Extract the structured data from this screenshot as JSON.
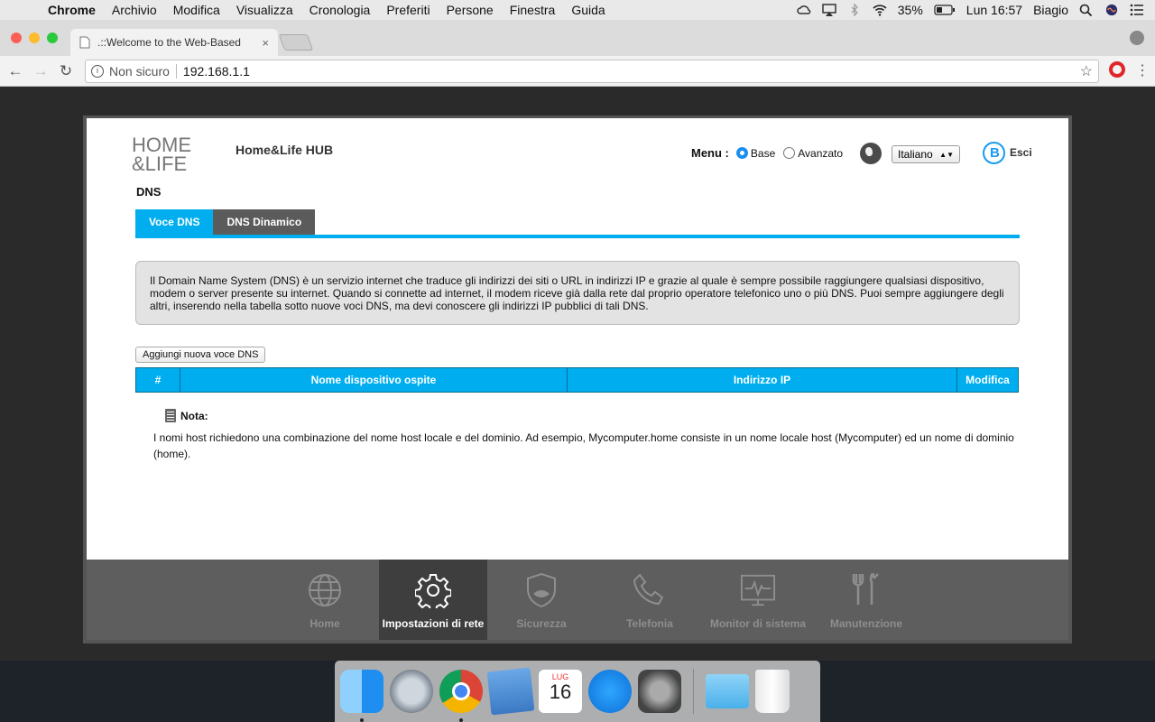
{
  "menubar": {
    "app": "Chrome",
    "items": [
      "Archivio",
      "Modifica",
      "Visualizza",
      "Cronologia",
      "Preferiti",
      "Persone",
      "Finestra",
      "Guida"
    ],
    "battery": "35%",
    "clock": "Lun 16:57",
    "user": "Biagio"
  },
  "browser": {
    "tab_title": ".::Welcome to the Web-Based",
    "security_label": "Non sicuro",
    "url": "192.168.1.1"
  },
  "router": {
    "logo_line1": "HOME",
    "logo_line2": "&LIFE",
    "hub_name": "Home&Life HUB",
    "menu_label": "Menu :",
    "mode_base": "Base",
    "mode_advanced": "Avanzato",
    "language": "Italiano",
    "exit_label": "Esci",
    "section_title": "DNS",
    "tabs": [
      {
        "label": "Voce DNS",
        "active": true
      },
      {
        "label": "DNS Dinamico",
        "active": false
      }
    ],
    "info_text": "Il Domain Name System (DNS) è un servizio internet che traduce gli indirizzi dei siti o URL in indirizzi IP e grazie al quale è sempre possibile raggiungere qualsiasi dispositivo, modem o server presente su internet. Quando si connette ad internet, il modem riceve già dalla rete dal proprio operatore telefonico uno o più DNS. Puoi sempre aggiungere degli altri, inserendo nella tabella sotto nuove voci DNS, ma devi conoscere gli indirizzi IP pubblici di tali DNS.",
    "add_button": "Aggiungi nuova voce DNS",
    "table_headers": [
      "#",
      "Nome dispositivo ospite",
      "Indirizzo IP",
      "Modifica"
    ],
    "note_label": "Nota:",
    "note_text": "I nomi host richiedono una combinazione del nome host locale e del dominio. Ad esempio, Mycomputer.home consiste in un nome locale host (Mycomputer) ed un nome di dominio (home).",
    "nav": [
      {
        "label": "Home",
        "icon": "globe-icon",
        "active": false
      },
      {
        "label": "Impostazioni di rete",
        "icon": "gear-icon",
        "active": true
      },
      {
        "label": "Sicurezza",
        "icon": "shield-icon",
        "active": false
      },
      {
        "label": "Telefonia",
        "icon": "phone-icon",
        "active": false
      },
      {
        "label": "Monitor di sistema",
        "icon": "monitor-icon",
        "active": false
      },
      {
        "label": "Manutenzione",
        "icon": "tools-icon",
        "active": false
      }
    ]
  },
  "dock": {
    "calendar_month": "LUG",
    "calendar_day": "16"
  },
  "colors": {
    "accent": "#00aeef",
    "nav_bg": "#5e5e5e",
    "nav_active": "#3e3e3e"
  }
}
